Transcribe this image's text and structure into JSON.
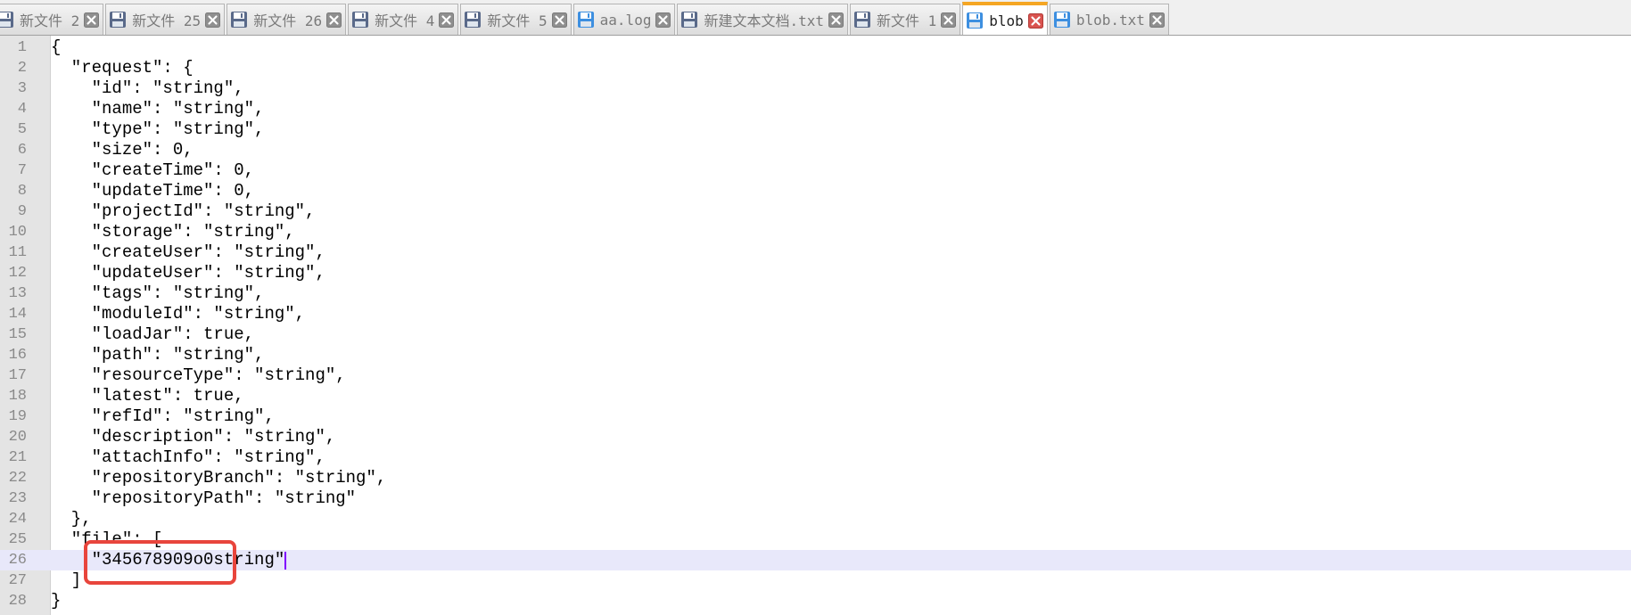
{
  "tabs": [
    {
      "label": "新文件 2",
      "icon": "floppy-disk-icon",
      "active": false
    },
    {
      "label": "新文件 25",
      "icon": "floppy-disk-icon",
      "active": false
    },
    {
      "label": "新文件 26",
      "icon": "floppy-disk-icon",
      "active": false
    },
    {
      "label": "新文件 4",
      "icon": "floppy-disk-icon",
      "active": false
    },
    {
      "label": "新文件 5",
      "icon": "floppy-disk-icon",
      "active": false
    },
    {
      "label": "aa.log",
      "icon": "floppy-disk-blue-icon",
      "active": false
    },
    {
      "label": "新建文本文档.txt",
      "icon": "floppy-disk-icon",
      "active": false
    },
    {
      "label": "新文件 1",
      "icon": "floppy-disk-icon",
      "active": false
    },
    {
      "label": "blob",
      "icon": "floppy-disk-blue-icon",
      "active": true
    },
    {
      "label": "blob.txt",
      "icon": "floppy-disk-blue-icon",
      "active": false
    }
  ],
  "editor": {
    "current_line": 26,
    "lines": [
      {
        "n": "1",
        "text": "{"
      },
      {
        "n": "2",
        "text": "  \"request\": {"
      },
      {
        "n": "3",
        "text": "    \"id\": \"string\","
      },
      {
        "n": "4",
        "text": "    \"name\": \"string\","
      },
      {
        "n": "5",
        "text": "    \"type\": \"string\","
      },
      {
        "n": "6",
        "text": "    \"size\": 0,"
      },
      {
        "n": "7",
        "text": "    \"createTime\": 0,"
      },
      {
        "n": "8",
        "text": "    \"updateTime\": 0,"
      },
      {
        "n": "9",
        "text": "    \"projectId\": \"string\","
      },
      {
        "n": "10",
        "text": "    \"storage\": \"string\","
      },
      {
        "n": "11",
        "text": "    \"createUser\": \"string\","
      },
      {
        "n": "12",
        "text": "    \"updateUser\": \"string\","
      },
      {
        "n": "13",
        "text": "    \"tags\": \"string\","
      },
      {
        "n": "14",
        "text": "    \"moduleId\": \"string\","
      },
      {
        "n": "15",
        "text": "    \"loadJar\": true,"
      },
      {
        "n": "16",
        "text": "    \"path\": \"string\","
      },
      {
        "n": "17",
        "text": "    \"resourceType\": \"string\","
      },
      {
        "n": "18",
        "text": "    \"latest\": true,"
      },
      {
        "n": "19",
        "text": "    \"refId\": \"string\","
      },
      {
        "n": "20",
        "text": "    \"description\": \"string\","
      },
      {
        "n": "21",
        "text": "    \"attachInfo\": \"string\","
      },
      {
        "n": "22",
        "text": "    \"repositoryBranch\": \"string\","
      },
      {
        "n": "23",
        "text": "    \"repositoryPath\": \"string\""
      },
      {
        "n": "24",
        "text": "  },"
      },
      {
        "n": "25",
        "text": "  \"file\": ["
      },
      {
        "n": "26",
        "text": "    \"345678909o0string\""
      },
      {
        "n": "27",
        "text": "  ]"
      },
      {
        "n": "28",
        "text": "}"
      }
    ]
  },
  "colors": {
    "active_tab_accent": "#f5a623",
    "current_line_bg": "#e8e8fa",
    "annotation_box": "#e8453c",
    "caret": "#8000ff"
  }
}
